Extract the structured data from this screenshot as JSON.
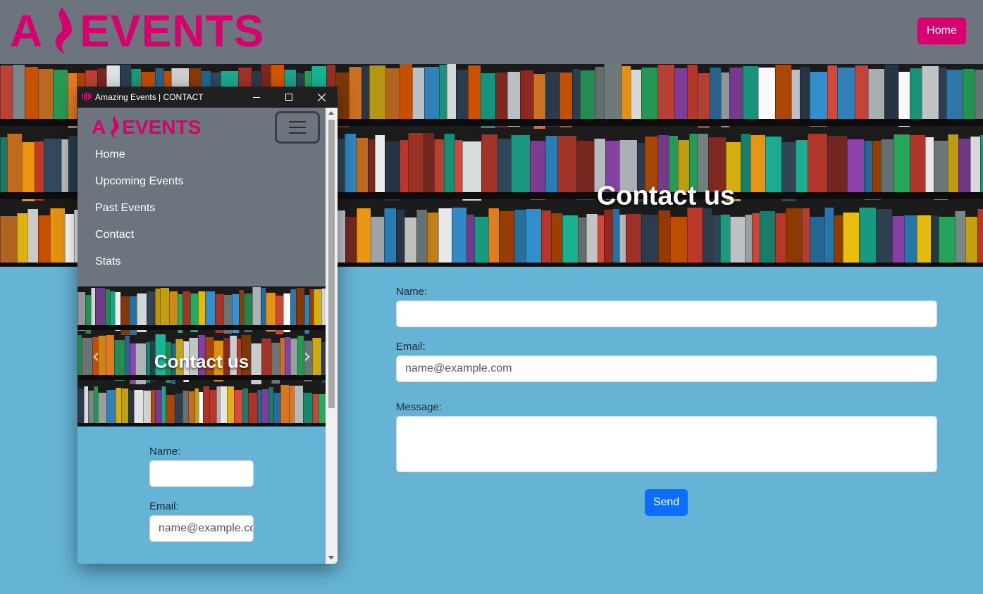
{
  "brand": {
    "logo_text": "EVENTS",
    "accent": "#d6006e"
  },
  "header": {
    "home_button": "Home",
    "bg": "#6c757d"
  },
  "hero": {
    "title": "Contact us",
    "image": "bookshelf"
  },
  "form": {
    "name_label": "Name:",
    "name_value": "",
    "email_label": "Email:",
    "email_placeholder": "name@example.com",
    "message_label": "Message:",
    "message_value": "",
    "send_button": "Send"
  },
  "window": {
    "title": "Amazing Events | CONTACT",
    "controls": [
      "minimize-icon",
      "maximize-icon",
      "close-icon"
    ],
    "nav_items": [
      "Home",
      "Upcoming Events",
      "Past Events",
      "Contact",
      "Stats"
    ],
    "hero_title": "Contact us",
    "form": {
      "name_label": "Name:",
      "name_value": "",
      "email_label": "Email:",
      "email_placeholder": "name@example.com"
    }
  },
  "colors": {
    "page_bg": "#65b3d5",
    "primary": "#0d6efd",
    "titlebar": "#202020"
  }
}
